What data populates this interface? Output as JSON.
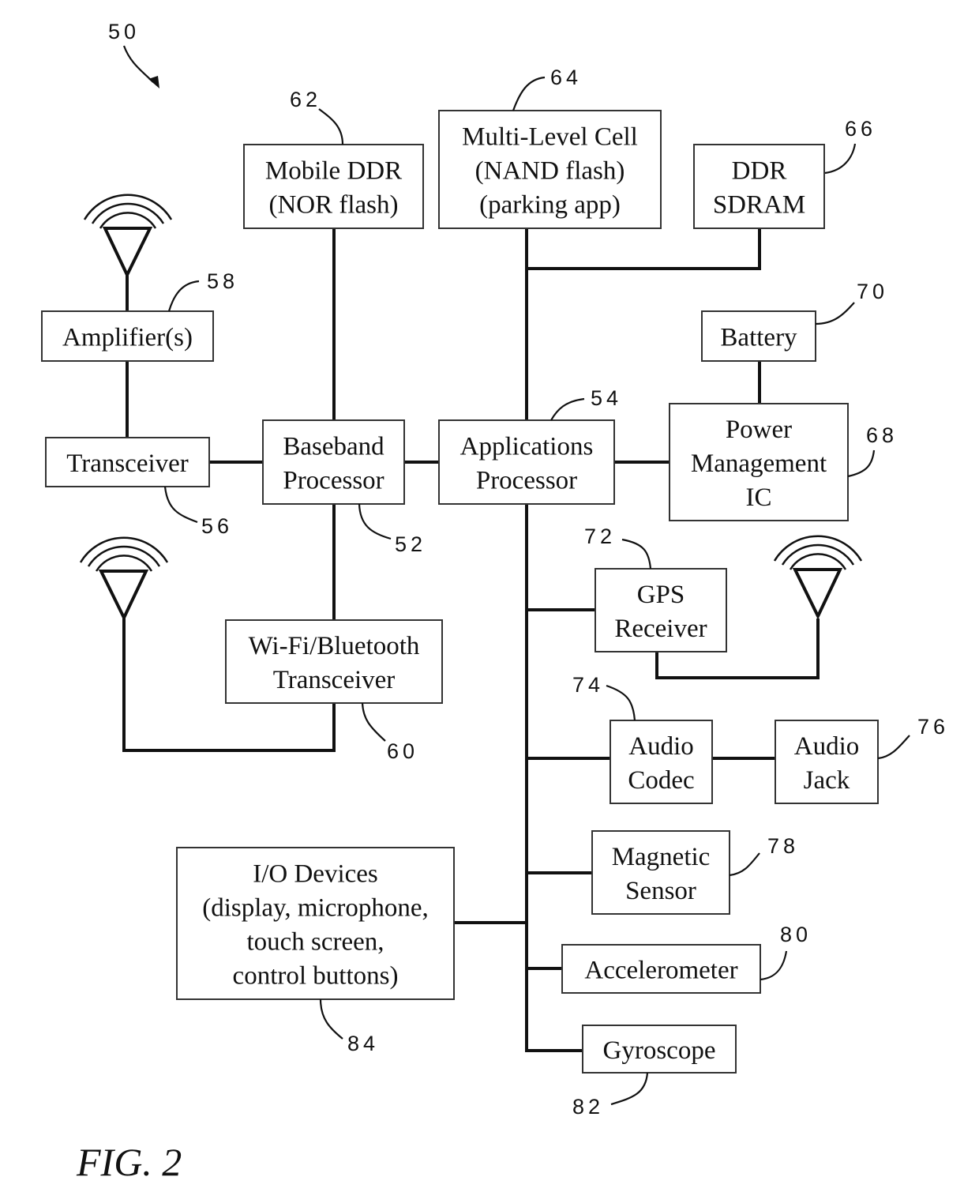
{
  "figure": {
    "label": "FIG. 2",
    "system_ref": "50"
  },
  "blocks": {
    "baseband": {
      "ref": "52",
      "lines": [
        "Baseband",
        "Processor"
      ]
    },
    "apps": {
      "ref": "54",
      "lines": [
        "Applications",
        "Processor"
      ]
    },
    "transceiver": {
      "ref": "56",
      "lines": [
        "Transceiver"
      ]
    },
    "amplifier": {
      "ref": "58",
      "lines": [
        "Amplifier(s)"
      ]
    },
    "wifi": {
      "ref": "60",
      "lines": [
        "Wi-Fi/Bluetooth",
        "Transceiver"
      ]
    },
    "mobile_ddr": {
      "ref": "62",
      "lines": [
        "Mobile DDR",
        "(NOR flash)"
      ]
    },
    "mlc": {
      "ref": "64",
      "lines": [
        "Multi-Level Cell",
        "(NAND flash)",
        "(parking app)"
      ]
    },
    "ddr_sdram": {
      "ref": "66",
      "lines": [
        "DDR",
        "SDRAM"
      ]
    },
    "pmic": {
      "ref": "68",
      "lines": [
        "Power",
        "Management",
        "IC"
      ]
    },
    "battery": {
      "ref": "70",
      "lines": [
        "Battery"
      ]
    },
    "gps": {
      "ref": "72",
      "lines": [
        "GPS",
        "Receiver"
      ]
    },
    "audio_codec": {
      "ref": "74",
      "lines": [
        "Audio",
        "Codec"
      ]
    },
    "audio_jack": {
      "ref": "76",
      "lines": [
        "Audio",
        "Jack"
      ]
    },
    "magnetic": {
      "ref": "78",
      "lines": [
        "Magnetic",
        "Sensor"
      ]
    },
    "accel": {
      "ref": "80",
      "lines": [
        "Accelerometer"
      ]
    },
    "gyro": {
      "ref": "82",
      "lines": [
        "Gyroscope"
      ]
    },
    "io": {
      "ref": "84",
      "lines": [
        "I/O Devices",
        "(display, microphone,",
        "touch screen,",
        "control buttons)"
      ]
    }
  },
  "icons": {
    "antennas": [
      "cellular-antenna-icon",
      "wifi-antenna-icon",
      "gps-antenna-icon"
    ]
  }
}
